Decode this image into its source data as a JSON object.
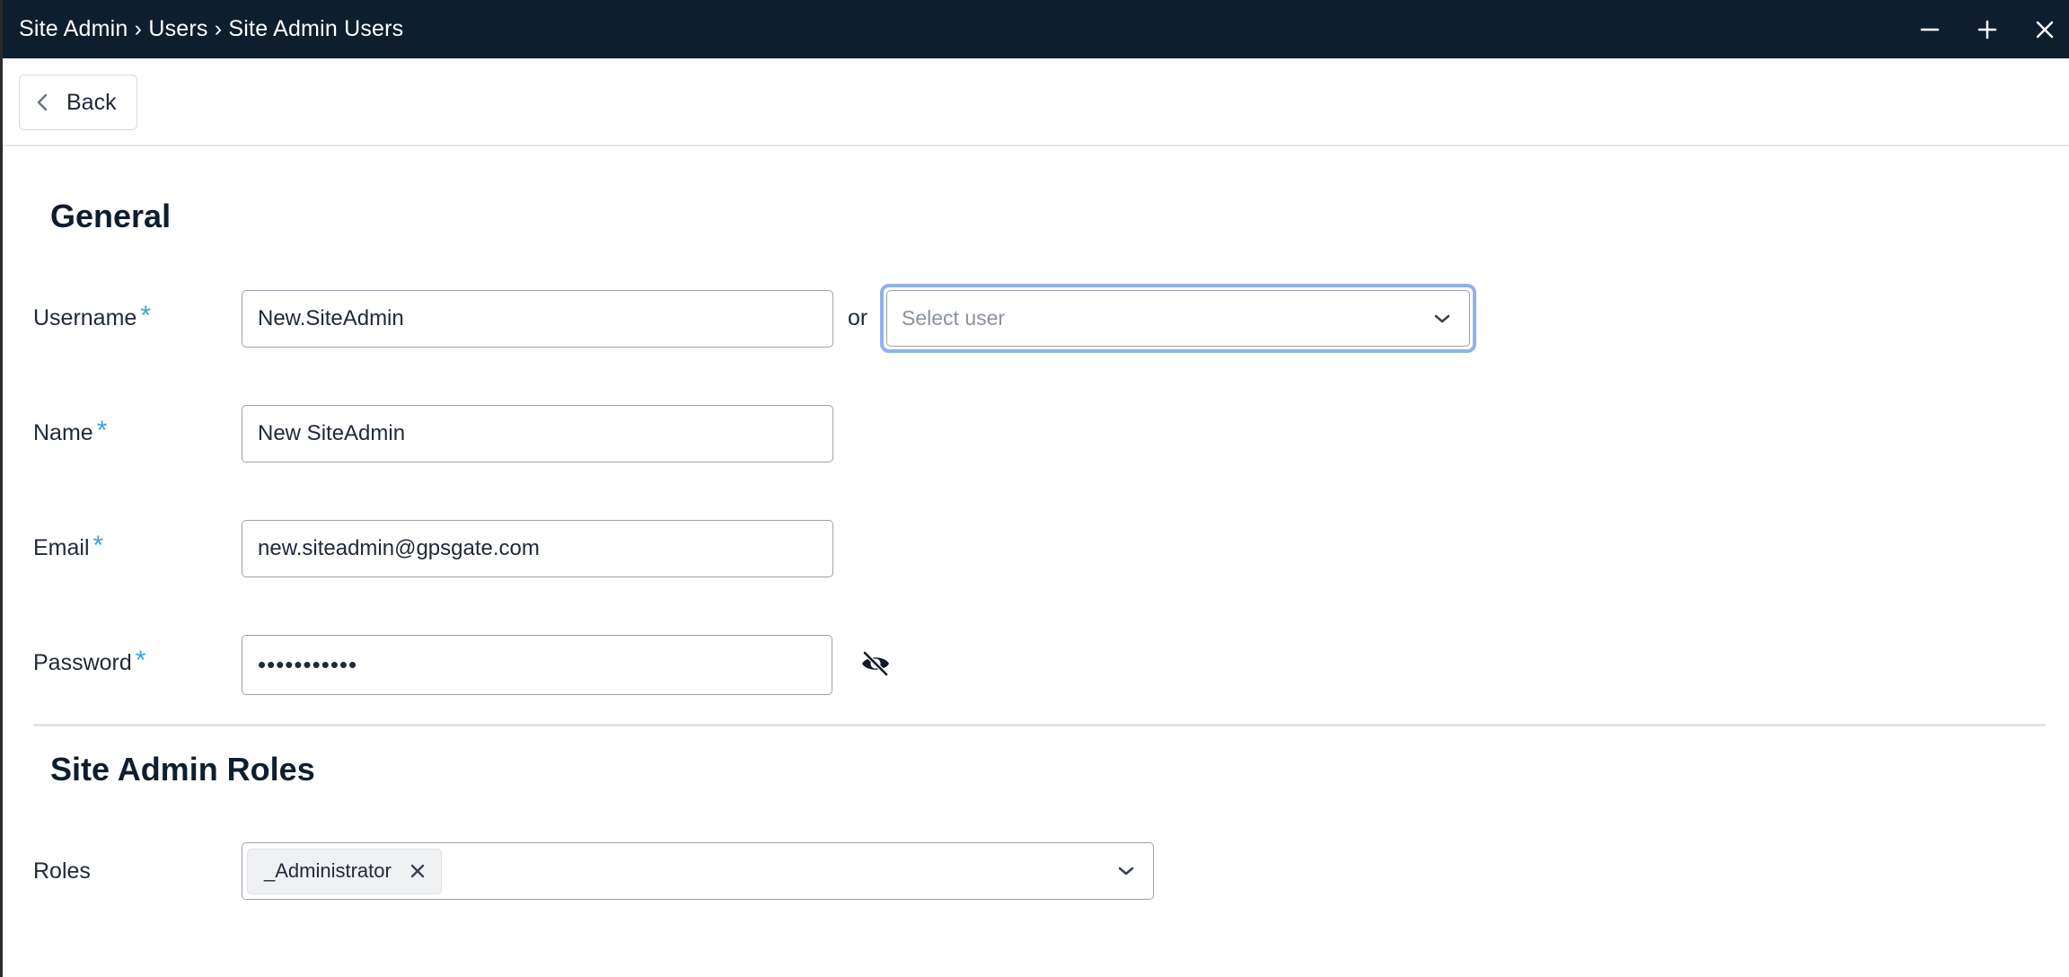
{
  "window": {
    "title": "Site Admin › Users › Site Admin Users",
    "controls": [
      "minimize-icon",
      "maximize-icon",
      "close-icon"
    ]
  },
  "toolbar": {
    "back_label": "Back"
  },
  "general": {
    "heading": "General",
    "username": {
      "label": "Username",
      "required_mark": "*",
      "value": "New.SiteAdmin",
      "or_text": "or",
      "select_placeholder": "Select user"
    },
    "name": {
      "label": "Name",
      "required_mark": "*",
      "value": "New SiteAdmin"
    },
    "email": {
      "label": "Email",
      "required_mark": "*",
      "value": "new.siteadmin@gpsgate.com"
    },
    "password": {
      "label": "Password",
      "required_mark": "*",
      "value": "•••••••••••",
      "toggle_icon": "eye-slash-icon"
    }
  },
  "roles_section": {
    "heading": "Site Admin Roles",
    "roles": {
      "label": "Roles",
      "selected": [
        "_Administrator"
      ]
    }
  },
  "colors": {
    "titlebar_bg": "#0f1e2e",
    "required_star": "#3ba3d8",
    "focus_ring": "#8fb2ee"
  }
}
